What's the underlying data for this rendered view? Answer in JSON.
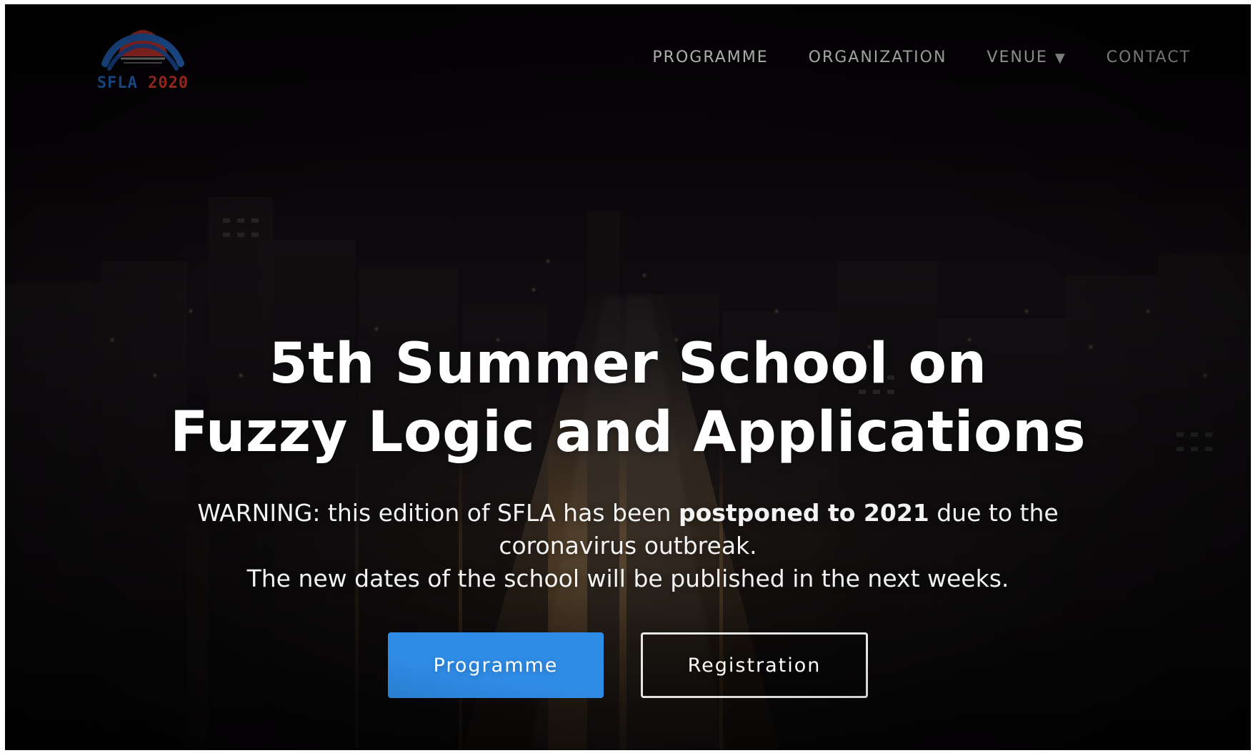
{
  "colors": {
    "primary_button": "#2f8ce6",
    "logo_red": "#e83a2e",
    "logo_blue": "#2a74d8"
  },
  "header": {
    "logo": {
      "text_left": "SFLA",
      "text_right": "2020"
    },
    "nav": {
      "items": [
        {
          "label": "PROGRAMME"
        },
        {
          "label": "ORGANIZATION"
        },
        {
          "label": "VENUE",
          "dropdown_caret": "▼"
        },
        {
          "label": "CONTACT"
        }
      ]
    }
  },
  "hero": {
    "title_line_1": "5th Summer School on",
    "title_line_2": "Fuzzy Logic and Applications",
    "warning": {
      "line_1_prefix": "WARNING: this edition of SFLA has been ",
      "line_1_strong": "postponed to 2021",
      "line_1_suffix": " due to the",
      "line_2": "coronavirus outbreak.",
      "line_3": "The new dates of the school will be published in the next weeks."
    },
    "buttons": {
      "primary": "Programme",
      "secondary": "Registration"
    }
  }
}
